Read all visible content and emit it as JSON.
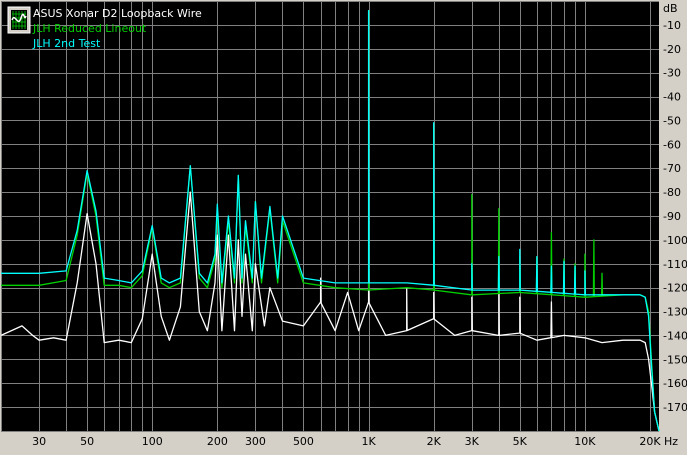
{
  "chart_data": {
    "type": "line",
    "xscale": "log",
    "xlim": [
      20,
      22000
    ],
    "ylim": [
      -180,
      0
    ],
    "yunit": "dB",
    "xunit": "Hz",
    "grid": true,
    "legend_position": "top-left",
    "background_color": "#000000",
    "frame_color": "#d4d0c8",
    "grid_color": "#808080",
    "xticks": [
      {
        "value": 30,
        "label": "30"
      },
      {
        "value": 50,
        "label": "50"
      },
      {
        "value": 100,
        "label": "100"
      },
      {
        "value": 200,
        "label": "200"
      },
      {
        "value": 300,
        "label": "300"
      },
      {
        "value": 500,
        "label": "500"
      },
      {
        "value": 1000,
        "label": "1K"
      },
      {
        "value": 2000,
        "label": "2K"
      },
      {
        "value": 3000,
        "label": "3K"
      },
      {
        "value": 5000,
        "label": "5K"
      },
      {
        "value": 10000,
        "label": "10K"
      },
      {
        "value": 20000,
        "label": "20K"
      }
    ],
    "yticks": [
      {
        "value": -10,
        "label": "-10"
      },
      {
        "value": -20,
        "label": "-20"
      },
      {
        "value": -30,
        "label": "-30"
      },
      {
        "value": -40,
        "label": "-40"
      },
      {
        "value": -50,
        "label": "-50"
      },
      {
        "value": -60,
        "label": "-60"
      },
      {
        "value": -70,
        "label": "-70"
      },
      {
        "value": -80,
        "label": "-80"
      },
      {
        "value": -90,
        "label": "-90"
      },
      {
        "value": -100,
        "label": "-100"
      },
      {
        "value": -110,
        "label": "-110"
      },
      {
        "value": -120,
        "label": "-120"
      },
      {
        "value": -130,
        "label": "-130"
      },
      {
        "value": -140,
        "label": "-140"
      },
      {
        "value": -150,
        "label": "-150"
      },
      {
        "value": -160,
        "label": "-160"
      },
      {
        "value": -170,
        "label": "-170"
      }
    ],
    "series": [
      {
        "name": "ASUS Xonar D2 Loopback Wire",
        "color": "#ffffff",
        "points": [
          [
            20,
            -140
          ],
          [
            25,
            -136
          ],
          [
            28,
            -140
          ],
          [
            30,
            -142
          ],
          [
            35,
            -141
          ],
          [
            40,
            -142
          ],
          [
            45,
            -118
          ],
          [
            50,
            -89
          ],
          [
            55,
            -110
          ],
          [
            60,
            -143
          ],
          [
            70,
            -142
          ],
          [
            80,
            -143
          ],
          [
            90,
            -133
          ],
          [
            100,
            -106
          ],
          [
            110,
            -132
          ],
          [
            120,
            -142
          ],
          [
            135,
            -128
          ],
          [
            150,
            -80
          ],
          [
            165,
            -130
          ],
          [
            180,
            -138
          ],
          [
            195,
            -118
          ],
          [
            200,
            -98
          ],
          [
            210,
            -138
          ],
          [
            225,
            -98
          ],
          [
            240,
            -138
          ],
          [
            250,
            -100
          ],
          [
            260,
            -132
          ],
          [
            270,
            -106
          ],
          [
            290,
            -138
          ],
          [
            300,
            -110
          ],
          [
            330,
            -136
          ],
          [
            350,
            -120
          ],
          [
            400,
            -134
          ],
          [
            500,
            -136
          ],
          [
            600,
            -126
          ],
          [
            700,
            -138
          ],
          [
            800,
            -122
          ],
          [
            900,
            -138
          ],
          [
            1000,
            -126
          ],
          [
            1200,
            -140
          ],
          [
            1500,
            -138
          ],
          [
            2000,
            -133
          ],
          [
            2500,
            -140
          ],
          [
            3000,
            -138
          ],
          [
            4000,
            -140
          ],
          [
            5000,
            -139
          ],
          [
            6000,
            -142
          ],
          [
            8000,
            -140
          ],
          [
            10000,
            -141
          ],
          [
            12000,
            -143
          ],
          [
            15000,
            -142
          ],
          [
            18000,
            -142
          ],
          [
            19000,
            -143
          ],
          [
            19700,
            -150
          ],
          [
            20300,
            -160
          ],
          [
            21000,
            -172
          ],
          [
            22000,
            -180
          ]
        ],
        "peaks": [
          [
            600,
            -116
          ],
          [
            1000,
            -118
          ],
          [
            1500,
            -120
          ],
          [
            2000,
            -122
          ],
          [
            3000,
            -124
          ],
          [
            4000,
            -122
          ],
          [
            5000,
            -124
          ],
          [
            7000,
            -126
          ]
        ]
      },
      {
        "name": "JLH Reduced Lineout",
        "color": "#00d000",
        "points": [
          [
            20,
            -119
          ],
          [
            30,
            -119
          ],
          [
            40,
            -117
          ],
          [
            45,
            -98
          ],
          [
            50,
            -72
          ],
          [
            55,
            -90
          ],
          [
            60,
            -119
          ],
          [
            70,
            -119
          ],
          [
            80,
            -120
          ],
          [
            90,
            -115
          ],
          [
            100,
            -95
          ],
          [
            110,
            -118
          ],
          [
            120,
            -120
          ],
          [
            135,
            -118
          ],
          [
            150,
            -69
          ],
          [
            165,
            -116
          ],
          [
            180,
            -120
          ],
          [
            195,
            -108
          ],
          [
            200,
            -87
          ],
          [
            210,
            -120
          ],
          [
            225,
            -92
          ],
          [
            240,
            -118
          ],
          [
            250,
            -73
          ],
          [
            260,
            -118
          ],
          [
            270,
            -94
          ],
          [
            290,
            -118
          ],
          [
            300,
            -84
          ],
          [
            320,
            -118
          ],
          [
            350,
            -87
          ],
          [
            380,
            -118
          ],
          [
            400,
            -92
          ],
          [
            500,
            -118
          ],
          [
            700,
            -120
          ],
          [
            1000,
            -121
          ],
          [
            1500,
            -120
          ],
          [
            2000,
            -121
          ],
          [
            3000,
            -123
          ],
          [
            5000,
            -122
          ],
          [
            10000,
            -124
          ],
          [
            15000,
            -123
          ],
          [
            18000,
            -123
          ],
          [
            19000,
            -124
          ],
          [
            19700,
            -130
          ],
          [
            20300,
            -150
          ],
          [
            21000,
            -172
          ],
          [
            22000,
            -180
          ]
        ],
        "peaks": [
          [
            1000,
            -4
          ],
          [
            2000,
            -52
          ],
          [
            3000,
            -81
          ],
          [
            4000,
            -87
          ],
          [
            5000,
            -107
          ],
          [
            6000,
            -107
          ],
          [
            7000,
            -97
          ],
          [
            8000,
            -108
          ],
          [
            9000,
            -110
          ],
          [
            10000,
            -106
          ],
          [
            11000,
            -100
          ],
          [
            12000,
            -114
          ]
        ]
      },
      {
        "name": "JLH 2nd Test",
        "color": "#00ffff",
        "points": [
          [
            20,
            -114
          ],
          [
            30,
            -114
          ],
          [
            40,
            -113
          ],
          [
            45,
            -96
          ],
          [
            50,
            -71
          ],
          [
            55,
            -88
          ],
          [
            60,
            -116
          ],
          [
            70,
            -117
          ],
          [
            80,
            -118
          ],
          [
            90,
            -113
          ],
          [
            100,
            -94
          ],
          [
            110,
            -116
          ],
          [
            120,
            -118
          ],
          [
            135,
            -116
          ],
          [
            150,
            -69
          ],
          [
            165,
            -114
          ],
          [
            180,
            -118
          ],
          [
            195,
            -106
          ],
          [
            200,
            -85
          ],
          [
            210,
            -118
          ],
          [
            225,
            -90
          ],
          [
            240,
            -116
          ],
          [
            250,
            -73
          ],
          [
            260,
            -116
          ],
          [
            270,
            -92
          ],
          [
            290,
            -116
          ],
          [
            300,
            -84
          ],
          [
            320,
            -116
          ],
          [
            350,
            -86
          ],
          [
            380,
            -116
          ],
          [
            400,
            -90
          ],
          [
            500,
            -116
          ],
          [
            700,
            -118
          ],
          [
            1000,
            -118
          ],
          [
            1500,
            -118
          ],
          [
            2000,
            -119
          ],
          [
            3000,
            -121
          ],
          [
            5000,
            -121
          ],
          [
            10000,
            -123
          ],
          [
            15000,
            -123
          ],
          [
            18000,
            -123
          ],
          [
            19000,
            -124
          ],
          [
            19700,
            -132
          ],
          [
            20300,
            -152
          ],
          [
            21000,
            -172
          ],
          [
            22000,
            -180
          ]
        ],
        "peaks": [
          [
            1000,
            -4
          ],
          [
            2000,
            -51
          ],
          [
            3000,
            -110
          ],
          [
            4000,
            -107
          ],
          [
            5000,
            -104
          ],
          [
            6000,
            -107
          ],
          [
            7000,
            -111
          ],
          [
            8000,
            -109
          ],
          [
            9000,
            -111
          ],
          [
            10000,
            -113
          ]
        ]
      }
    ]
  }
}
